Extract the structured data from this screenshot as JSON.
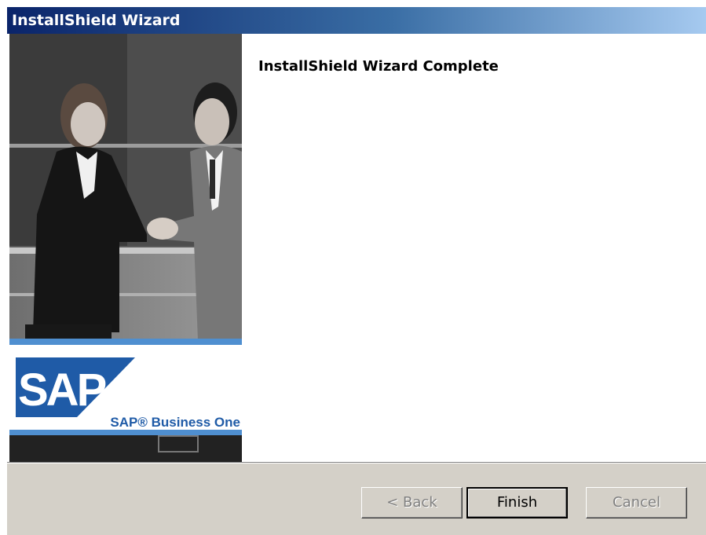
{
  "window": {
    "title": "InstallShield Wizard"
  },
  "page": {
    "heading": "InstallShield Wizard Complete"
  },
  "side_image": {
    "logo_text": "SAP",
    "product_name": "SAP® Business One",
    "colors": {
      "logo_blue": "#1f5ba7",
      "band_blue": "#4f8fd0"
    }
  },
  "buttons": {
    "back_label": "< Back",
    "finish_label": "Finish",
    "cancel_label": "Cancel"
  }
}
